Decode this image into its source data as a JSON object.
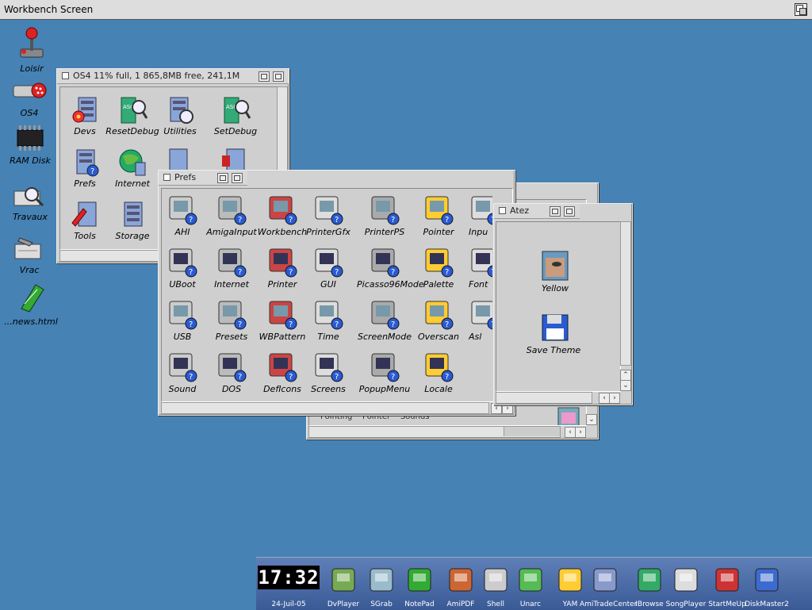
{
  "screen_title": "Workbench Screen",
  "desktop_icons": [
    {
      "label": "Loisir",
      "icon": "joystick-icon"
    },
    {
      "label": "OS4",
      "icon": "harddisk-icon"
    },
    {
      "label": "RAM Disk",
      "icon": "ram-chip-icon"
    },
    {
      "label": "Travaux",
      "icon": "drawer-magnifier-icon"
    },
    {
      "label": "Vrac",
      "icon": "drawer-tools-icon"
    },
    {
      "label": "...news.html",
      "icon": "notepad-icon"
    }
  ],
  "os4_window": {
    "title": "OS4  11% full, 1 865,8MB free, 241,1M",
    "icons": [
      "Devs",
      "ResetDebug",
      "Utilities",
      "SetDebug",
      "Prefs",
      "Internet",
      "Tools",
      "Storage"
    ]
  },
  "prefs_window": {
    "title": "Prefs",
    "icons": [
      "AHI",
      "AmigaInput",
      "Workbench",
      "PrinterGfx",
      "PrinterPS",
      "Pointer",
      "Inpu",
      "UBoot",
      "Internet",
      "Printer",
      "GUI",
      "Picasso96Mode",
      "Palette",
      "Font",
      "USB",
      "Presets",
      "WBPattern",
      "Time",
      "ScreenMode",
      "Overscan",
      "Asl",
      "Sound",
      "DOS",
      "DefIcons",
      "Screens",
      "PopupMenu",
      "Locale"
    ]
  },
  "back_window": {
    "partial_labels": [
      "Pointing",
      "Pointer",
      "Sounds"
    ]
  },
  "atez_window": {
    "title": "Atez",
    "icons": [
      "Yellow",
      "Save Theme"
    ]
  },
  "dock": {
    "clock": "17:32",
    "date": "24-Juil-05",
    "items": [
      "DvPlayer",
      "SGrab",
      "NotePad",
      "AmiPDF",
      "Shell",
      "Unarc",
      "YAM",
      "AmiTradeCenter",
      "IBrowse",
      "SongPlayer",
      "StartMeUp",
      "DiskMaster2"
    ]
  }
}
